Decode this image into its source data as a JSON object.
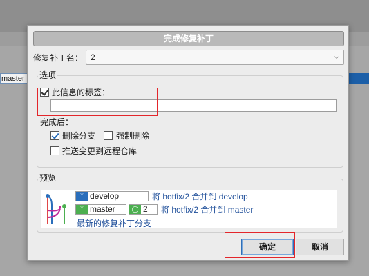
{
  "background": {
    "branch_label": "master"
  },
  "dialog": {
    "title": "完成修复补丁",
    "name_label": "修复补丁名：",
    "name_value": "2",
    "options": {
      "group_label": "选项",
      "message_checkbox_label": "此信息的标签：",
      "message_checked": true,
      "message_value": "",
      "after_label": "完成后：",
      "delete_branch_label": "删除分支",
      "delete_branch_checked": true,
      "force_delete_label": "强制删除",
      "force_delete_checked": false,
      "push_label": "推送变更到远程仓库",
      "push_checked": false
    },
    "preview": {
      "group_label": "预览",
      "row1": {
        "branch": "develop",
        "text": "将 hotfix/2 合并到 develop"
      },
      "row2": {
        "branch": "master",
        "tag": "2",
        "text": "将 hotfix/2 合并到 master"
      },
      "row3": {
        "text": "最新的修复补丁分支"
      }
    },
    "ok_button": "确定",
    "cancel_button": "取消"
  },
  "colors": {
    "highlight_red": "#e3262b",
    "develop_branch": "#2a6ebb",
    "master_branch": "#4caf50",
    "link_blue": "#1f4f9a"
  }
}
